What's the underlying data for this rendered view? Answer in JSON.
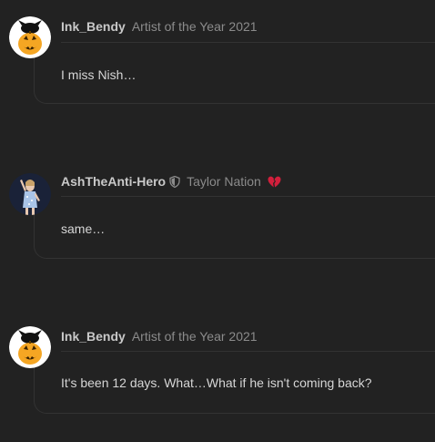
{
  "posts": [
    {
      "username": "Ink_Bendy",
      "rank": "Artist of the Year 2021",
      "message": "I miss Nish…",
      "avatar_icon": "bendy-pumpkin-avatar"
    },
    {
      "username": "AshTheAnti-Hero",
      "rank": "Taylor Nation",
      "message": "same…",
      "avatar_icon": "singer-avatar",
      "badges": [
        "shield-icon",
        "broken-heart-icon"
      ]
    },
    {
      "username": "Ink_Bendy",
      "rank": "Artist of the Year 2021",
      "message": "It's been 12 days. What…What if he isn't coming back?",
      "avatar_icon": "bendy-pumpkin-avatar"
    }
  ],
  "colors": {
    "background": "#222222",
    "username": "#c9c9c9",
    "rank": "#8b8b8b",
    "message": "#d6d6d6",
    "divider": "#333333",
    "heart": "#d21f3c"
  }
}
